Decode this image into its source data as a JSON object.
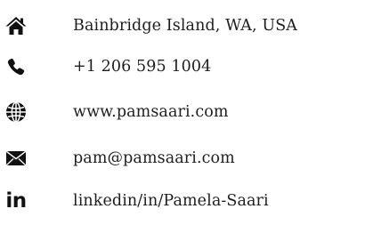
{
  "contacts": {
    "address": {
      "icon": "home-icon",
      "text": "Bainbridge Island, WA, USA"
    },
    "phone": {
      "icon": "phone-icon",
      "text": "+1 206 595 1004"
    },
    "website": {
      "icon": "globe-icon",
      "text": "www.pamsaari.com"
    },
    "email": {
      "icon": "envelope-icon",
      "text": "pam@pamsaari.com"
    },
    "linkedin": {
      "icon": "linkedin-icon",
      "glyph": "in",
      "text": "linkedin/in/Pamela-Saari"
    }
  },
  "colors": {
    "text": "#1e1e1e",
    "icon": "#111111",
    "background": "#ffffff"
  }
}
